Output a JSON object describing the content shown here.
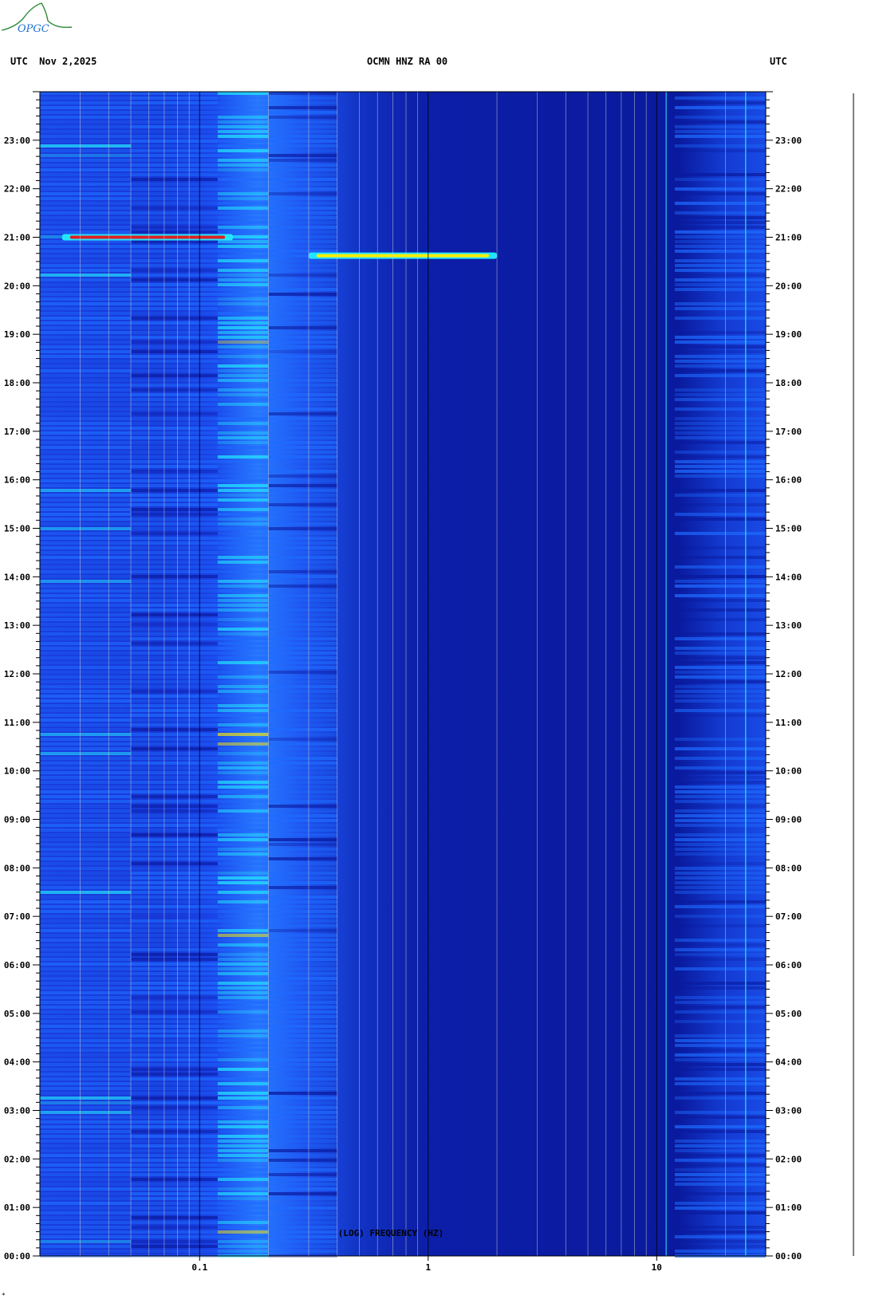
{
  "logo": {
    "text": "OPGC",
    "color": "#2e8b3a"
  },
  "header": {
    "left": "UTC  Nov 2,2025",
    "center": "OCMN HNZ RA 00",
    "right": "UTC"
  },
  "footer_mark": "*",
  "chart_data": {
    "type": "heatmap",
    "title": "OCMN HNZ RA 00",
    "date": "Nov 2,2025",
    "xlabel": "(LOG) FREQUENCY (HZ)",
    "x_scale": "log",
    "xlim": [
      0.02,
      30
    ],
    "x_ticks": [
      {
        "value": 0.1,
        "label": "0.1"
      },
      {
        "value": 1,
        "label": "1"
      },
      {
        "value": 10,
        "label": "10"
      }
    ],
    "ylabel": "UTC",
    "ylim": [
      0,
      24
    ],
    "y_ticks": [
      {
        "value": 0,
        "label": "00:00"
      },
      {
        "value": 1,
        "label": "01:00"
      },
      {
        "value": 2,
        "label": "02:00"
      },
      {
        "value": 3,
        "label": "03:00"
      },
      {
        "value": 4,
        "label": "04:00"
      },
      {
        "value": 5,
        "label": "05:00"
      },
      {
        "value": 6,
        "label": "06:00"
      },
      {
        "value": 7,
        "label": "07:00"
      },
      {
        "value": 8,
        "label": "08:00"
      },
      {
        "value": 9,
        "label": "09:00"
      },
      {
        "value": 10,
        "label": "10:00"
      },
      {
        "value": 11,
        "label": "11:00"
      },
      {
        "value": 12,
        "label": "12:00"
      },
      {
        "value": 13,
        "label": "13:00"
      },
      {
        "value": 14,
        "label": "14:00"
      },
      {
        "value": 15,
        "label": "15:00"
      },
      {
        "value": 16,
        "label": "16:00"
      },
      {
        "value": 17,
        "label": "17:00"
      },
      {
        "value": 18,
        "label": "18:00"
      },
      {
        "value": 19,
        "label": "19:00"
      },
      {
        "value": 20,
        "label": "20:00"
      },
      {
        "value": 21,
        "label": "21:00"
      },
      {
        "value": 22,
        "label": "22:00"
      },
      {
        "value": 23,
        "label": "23:00"
      }
    ],
    "grid": true,
    "colormap": {
      "low": "#0a1a9e",
      "mid": "#1e6bff",
      "high": "#22e6ff",
      "peak": "#ffee00",
      "max": "#e02020"
    },
    "energy_bands": [
      {
        "f_from": 0.02,
        "f_to": 0.05,
        "level": 0.55
      },
      {
        "f_from": 0.05,
        "f_to": 0.12,
        "level": 0.45
      },
      {
        "f_from": 0.12,
        "f_to": 0.2,
        "level": 0.75
      },
      {
        "f_from": 0.2,
        "f_to": 0.4,
        "level": 0.5
      },
      {
        "f_from": 0.4,
        "f_to": 12,
        "level": 0.1
      },
      {
        "f_from": 12,
        "f_to": 30,
        "level": 0.35
      }
    ],
    "events": [
      {
        "time": 21.0,
        "f_from": 0.025,
        "f_to": 0.14,
        "level": 1.0
      },
      {
        "time": 20.62,
        "f_from": 0.3,
        "f_to": 2.0,
        "level": 0.85
      }
    ],
    "spectral_lines": [
      {
        "freq": 11,
        "level": 0.7
      },
      {
        "freq": 24.5,
        "level": 0.8
      }
    ]
  }
}
